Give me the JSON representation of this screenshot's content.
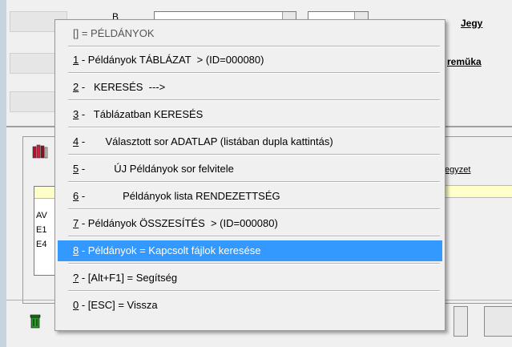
{
  "background": {
    "link_top": "Jegy",
    "link_mid": "remŭka",
    "link_note": "egyzet",
    "list_lines": [
      "AV",
      "E1",
      "E4"
    ],
    "letter_b": "B"
  },
  "menu": {
    "header": "[] = PÉLDÁNYOK",
    "items": [
      {
        "key": "1",
        "rest": " - Példányok TÁBLÁZAT  > (ID=000080)",
        "highlighted": false
      },
      {
        "key": "2",
        "rest": " -   KERESÉS  --->",
        "highlighted": false
      },
      {
        "key": "3",
        "rest": " -   Táblázatban KERESÉS",
        "highlighted": false
      },
      {
        "key": "4",
        "rest": " -       Választott sor ADATLAP (listában dupla kattintás)",
        "highlighted": false
      },
      {
        "key": "5",
        "rest": " -          ÚJ Példányok sor felvitele",
        "highlighted": false
      },
      {
        "key": "6",
        "rest": " -             Példányok lista RENDEZETTSÉG",
        "highlighted": false
      },
      {
        "key": "7",
        "rest": " - Példányok ÖSSZESÍTÉS  > (ID=000080)",
        "highlighted": false
      },
      {
        "key": "8",
        "rest": " - Példányok = Kapcsolt fájlok keresése",
        "highlighted": true
      },
      {
        "key": "?",
        "rest": " - [Alt+F1] = Segítség",
        "highlighted": false
      },
      {
        "key": "0",
        "rest": " - [ESC] = Vissza",
        "highlighted": false
      }
    ]
  },
  "colors": {
    "highlight": "#3399ff",
    "list_header_yellow": "#ffffc8"
  }
}
